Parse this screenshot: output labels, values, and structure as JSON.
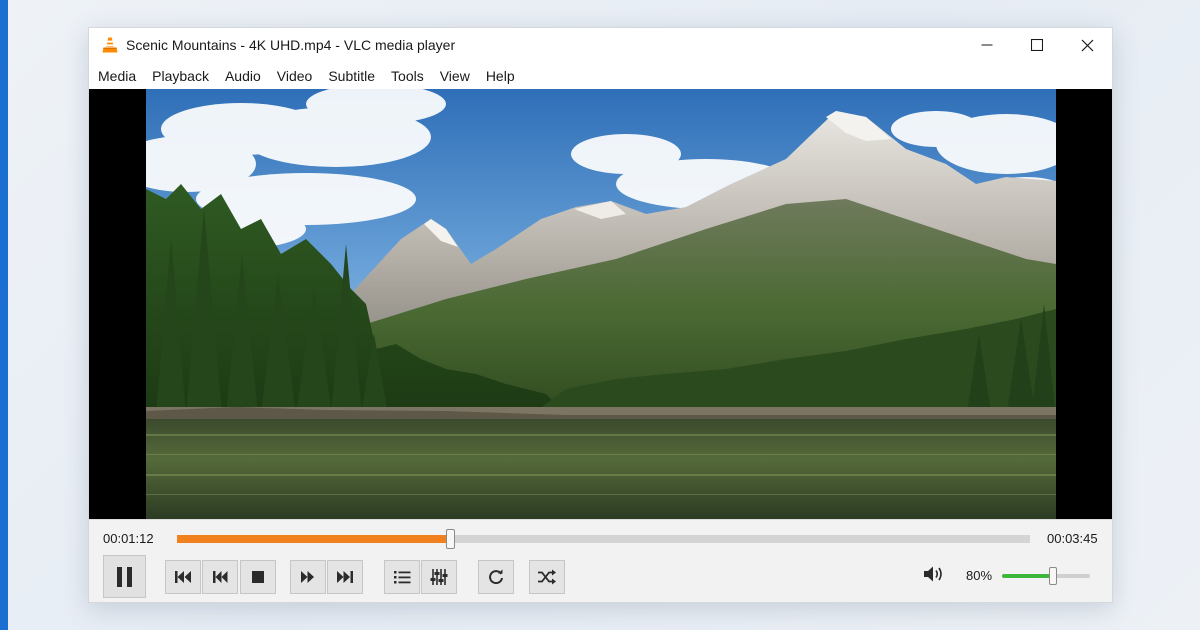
{
  "window": {
    "title": "Scenic Mountains - 4K UHD.mp4 - VLC media player",
    "app_icon": "vlc-cone-icon",
    "buttons": [
      "minimize-icon",
      "maximize-icon",
      "close-icon"
    ]
  },
  "menu": {
    "items": [
      "Media",
      "Playback",
      "Audio",
      "Video",
      "Subtitle",
      "Tools",
      "View",
      "Help"
    ]
  },
  "video": {
    "scene": "mountain lake landscape"
  },
  "playback": {
    "elapsed": "00:01:12",
    "total": "00:03:45",
    "progress_fraction": 0.32,
    "state_button_icon": "pause-icon"
  },
  "controls": {
    "buttons": [
      "previous-icon",
      "skip-back-icon",
      "stop-icon",
      "skip-forward-icon",
      "next-icon",
      "playlist-icon",
      "extended-settings-icon",
      "loop-icon",
      "shuffle-icon"
    ]
  },
  "volume": {
    "label": "80%",
    "level_fraction": 0.58,
    "icon": "speaker-icon"
  },
  "colors": {
    "progress": "#f1801f",
    "volume": "#3cb73c",
    "accent_bar": "#1b6fd0"
  }
}
